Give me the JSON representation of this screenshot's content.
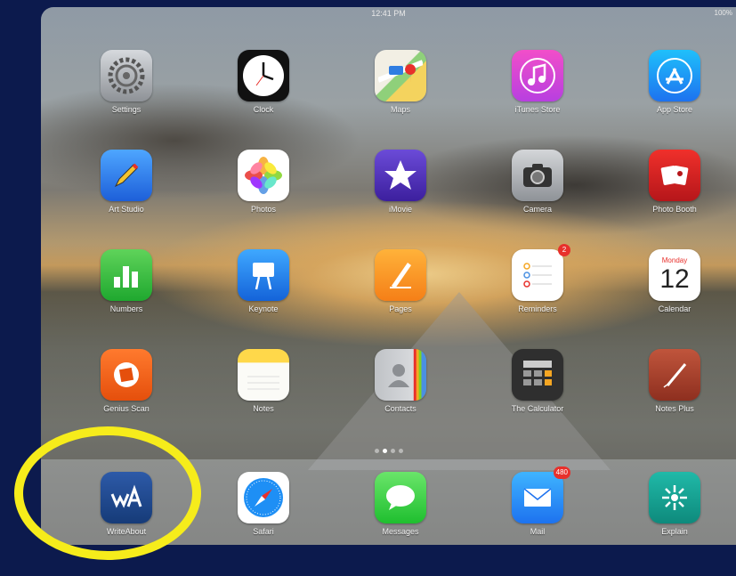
{
  "status_bar": {
    "time": "12:41 PM",
    "battery": "100%"
  },
  "home_rows": [
    [
      {
        "name": "settings",
        "label": "Settings",
        "icon": "gear-icon"
      },
      {
        "name": "clock",
        "label": "Clock",
        "icon": "clock-icon"
      },
      {
        "name": "maps",
        "label": "Maps",
        "icon": "map-icon"
      },
      {
        "name": "itunes-store",
        "label": "iTunes Store",
        "icon": "music-note-icon"
      },
      {
        "name": "app-store",
        "label": "App Store",
        "icon": "app-store-icon"
      }
    ],
    [
      {
        "name": "art-studio",
        "label": "Art Studio",
        "icon": "pencil-icon"
      },
      {
        "name": "photos",
        "label": "Photos",
        "icon": "photos-flower-icon"
      },
      {
        "name": "imovie",
        "label": "iMovie",
        "icon": "star-icon"
      },
      {
        "name": "camera",
        "label": "Camera",
        "icon": "camera-icon"
      },
      {
        "name": "photo-booth",
        "label": "Photo Booth",
        "icon": "photo-booth-icon"
      }
    ],
    [
      {
        "name": "numbers",
        "label": "Numbers",
        "icon": "bar-chart-icon"
      },
      {
        "name": "keynote",
        "label": "Keynote",
        "icon": "podium-icon"
      },
      {
        "name": "pages",
        "label": "Pages",
        "icon": "pen-nib-icon"
      },
      {
        "name": "reminders",
        "label": "Reminders",
        "icon": "list-icon",
        "badge": "2"
      },
      {
        "name": "calendar",
        "label": "Calendar",
        "icon": "calendar-icon",
        "weekday": "Monday",
        "day": "12"
      }
    ],
    [
      {
        "name": "genius-scan",
        "label": "Genius Scan",
        "icon": "scan-icon"
      },
      {
        "name": "notes",
        "label": "Notes",
        "icon": "notepad-icon"
      },
      {
        "name": "contacts",
        "label": "Contacts",
        "icon": "contacts-icon"
      },
      {
        "name": "the-calculator",
        "label": "The Calculator",
        "icon": "calculator-icon"
      },
      {
        "name": "notes-plus",
        "label": "Notes Plus",
        "icon": "stylus-icon"
      }
    ]
  ],
  "page_dots": {
    "count": 4,
    "active": 1
  },
  "dock": [
    {
      "name": "writeabout",
      "label": "WriteAbout",
      "icon": "writeabout-logo-icon"
    },
    {
      "name": "safari",
      "label": "Safari",
      "icon": "compass-icon"
    },
    {
      "name": "messages",
      "label": "Messages",
      "icon": "speech-bubble-icon"
    },
    {
      "name": "mail",
      "label": "Mail",
      "icon": "envelope-icon",
      "badge": "480"
    },
    {
      "name": "explain-everything",
      "label": "Explain",
      "icon": "explain-everything-icon"
    }
  ],
  "accent_colors": {
    "highlight": "#f6ec1b",
    "badge": "#e8302b",
    "background": "#0c1a4d"
  }
}
